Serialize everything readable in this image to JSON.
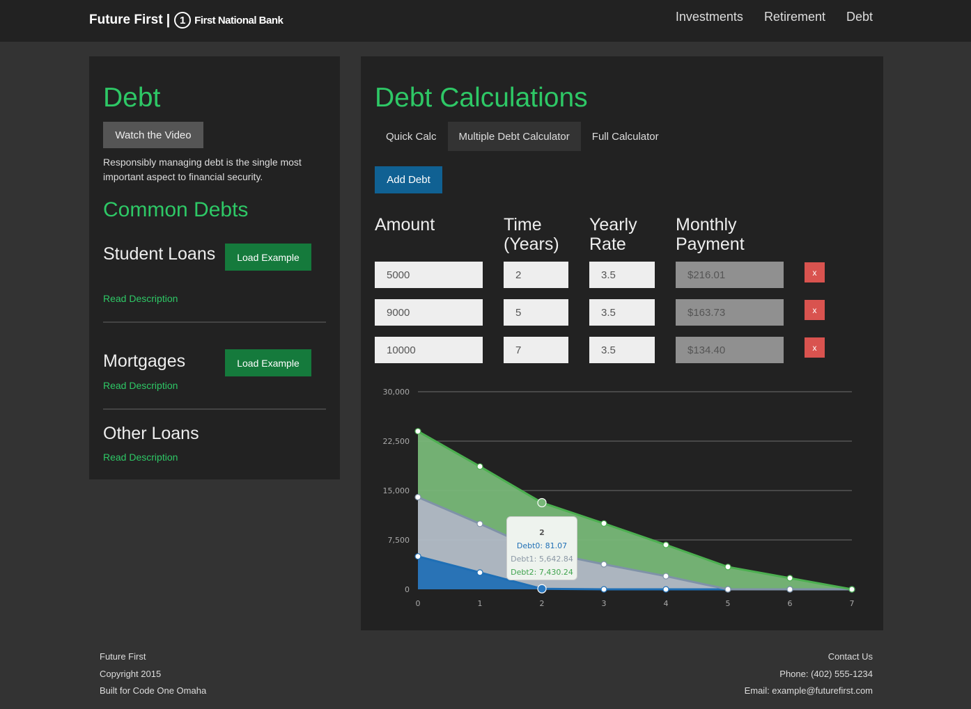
{
  "header": {
    "brand": "Future First",
    "separator": "|",
    "bank_logo_digit": "1",
    "bank_name": "First National Bank",
    "nav": [
      "Investments",
      "Retirement",
      "Debt"
    ]
  },
  "left_panel": {
    "title": "Debt",
    "video_button": "Watch the Video",
    "description": "Responsibly managing debt is the single most important aspect to financial security.",
    "subtitle": "Common Debts",
    "debts": [
      {
        "name": "Student Loans",
        "load_label": "Load Example",
        "read_label": "Read Description"
      },
      {
        "name": "Mortgages",
        "load_label": "Load Example",
        "read_label": "Read Description"
      },
      {
        "name": "Other Loans",
        "read_label": "Read Description"
      }
    ]
  },
  "calculator": {
    "title": "Debt Calculations",
    "tabs": [
      "Quick Calc",
      "Multiple Debt Calculator",
      "Full Calculator"
    ],
    "active_tab": "Multiple Debt Calculator",
    "add_button": "Add Debt",
    "columns": [
      "Amount",
      "Time (Years)",
      "Yearly Rate",
      "Monthly Payment"
    ],
    "rows": [
      {
        "amount": "5000",
        "time": "2",
        "rate": "3.5",
        "payment": "$216.01",
        "remove": "x"
      },
      {
        "amount": "9000",
        "time": "5",
        "rate": "3.5",
        "payment": "$163.73",
        "remove": "x"
      },
      {
        "amount": "10000",
        "time": "7",
        "rate": "3.5",
        "payment": "$134.40",
        "remove": "x"
      }
    ]
  },
  "chart_data": {
    "type": "area",
    "stacked": true,
    "x": [
      0,
      1,
      2,
      3,
      4,
      5,
      6,
      7
    ],
    "y_ticks": [
      "0",
      "7,500",
      "15,000",
      "22,500",
      "30,000"
    ],
    "ylim": [
      0,
      30000
    ],
    "grid": true,
    "series": [
      {
        "name": "Debt0",
        "color": "#2a78bf",
        "values": [
          5000,
          2550,
          81.07,
          0,
          0,
          0,
          0,
          0
        ]
      },
      {
        "name": "Debt1",
        "color": "#b4bec8",
        "values": [
          9000,
          7400,
          5642.84,
          3800,
          2000,
          0,
          0,
          0
        ]
      },
      {
        "name": "Debt2",
        "color": "#78b878",
        "values": [
          10000,
          8700,
          7430.24,
          6200,
          4750,
          3400,
          1700,
          0
        ]
      }
    ],
    "tooltip": {
      "title": "2",
      "lines": [
        "Debt0: 81.07",
        "Debt1: 5,642.84",
        "Debt2: 7,430.24"
      ]
    }
  },
  "footer": {
    "left": [
      "Future First",
      "Copyright 2015",
      "Built for Code One Omaha"
    ],
    "right": [
      "Contact Us",
      "Phone: (402) 555-1234",
      "Email: example@futurefirst.com"
    ]
  }
}
